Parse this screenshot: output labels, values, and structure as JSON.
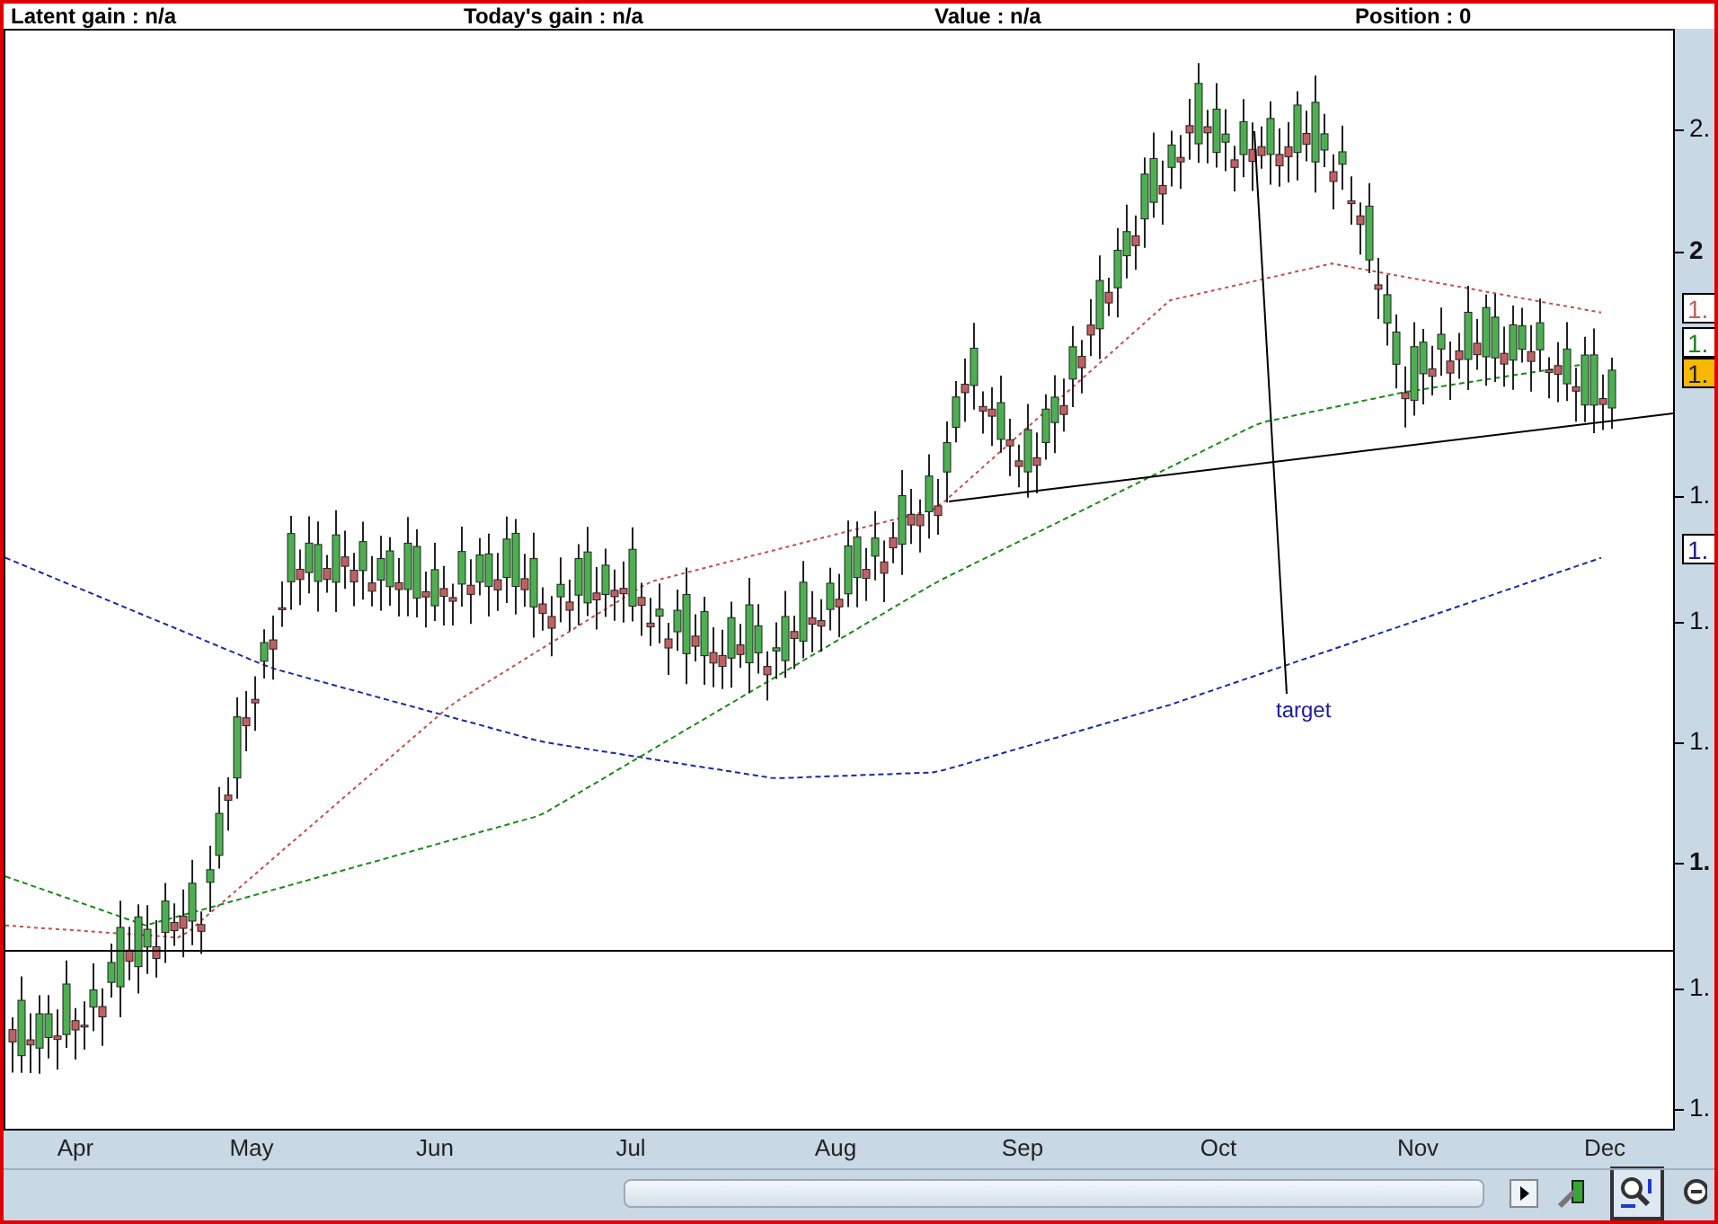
{
  "header": {
    "stats": [
      "Latent gain : n/a",
      "Today's gain : n/a",
      "Value : n/a",
      "Position : 0"
    ]
  },
  "chart": {
    "annotation": "target",
    "price_axis": {
      "ticks": [
        {
          "label": "2.",
          "major": false
        },
        {
          "label": "2",
          "major": true
        },
        {
          "label": "1.",
          "major": false
        },
        {
          "label": "1.",
          "major": false
        },
        {
          "label": "1.",
          "major": false
        },
        {
          "label": "1.",
          "major": true
        },
        {
          "label": "1.",
          "major": false
        },
        {
          "label": "1.",
          "major": false
        }
      ],
      "tags": [
        {
          "label": "1.",
          "kind": "outline",
          "color": "#c06060"
        },
        {
          "label": "1.",
          "kind": "outline",
          "color": "#208020"
        },
        {
          "label": "1.",
          "kind": "filled",
          "color": "#f8b800"
        },
        {
          "label": "1.",
          "kind": "outline",
          "color": "#202080"
        }
      ]
    },
    "months": [
      "Apr",
      "May",
      "Jun",
      "Jul",
      "Aug",
      "Sep",
      "Oct",
      "Nov",
      "Dec"
    ]
  },
  "toolbar": [
    {
      "kind": "scroll-right",
      "selected": false
    },
    {
      "kind": "chart-tool",
      "selected": false
    },
    {
      "kind": "zoom",
      "selected": true
    },
    {
      "kind": "zoom-out",
      "selected": false
    }
  ]
}
